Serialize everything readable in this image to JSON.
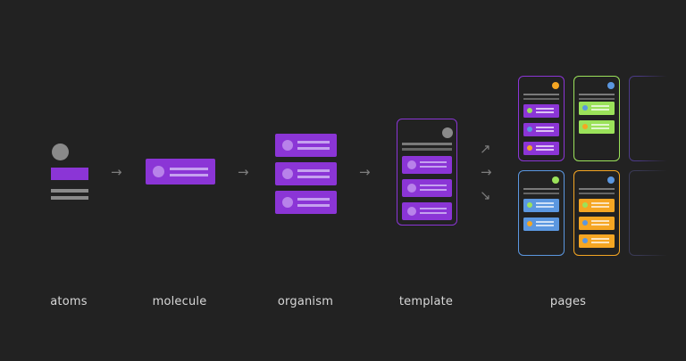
{
  "stages": {
    "atoms": "atoms",
    "molecule": "molecule",
    "organism": "organism",
    "template": "template",
    "pages": "pages"
  },
  "icons": {
    "arrow_right": "→",
    "arrow_up_right": "↗",
    "arrow_down_right": "↘"
  },
  "colors": {
    "background": "#222222",
    "purple": "#8b35d6",
    "green": "#9be25a",
    "blue": "#5b97e0",
    "orange": "#f5a623",
    "gray": "#8a8a8a"
  }
}
